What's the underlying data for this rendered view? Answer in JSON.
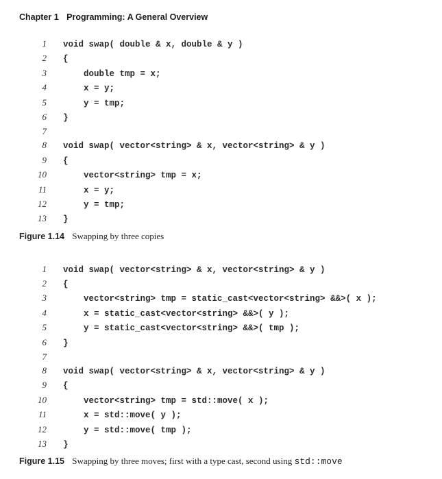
{
  "header": {
    "chapter_num": "Chapter 1",
    "chapter_title": "Programming: A General Overview"
  },
  "listing1": {
    "lines": [
      {
        "n": "1",
        "t": "void swap( double & x, double & y )"
      },
      {
        "n": "2",
        "t": "{"
      },
      {
        "n": "3",
        "t": "    double tmp = x;"
      },
      {
        "n": "4",
        "t": "    x = y;"
      },
      {
        "n": "5",
        "t": "    y = tmp;"
      },
      {
        "n": "6",
        "t": "}"
      },
      {
        "n": "7",
        "t": ""
      },
      {
        "n": "8",
        "t": "void swap( vector<string> & x, vector<string> & y )"
      },
      {
        "n": "9",
        "t": "{"
      },
      {
        "n": "10",
        "t": "    vector<string> tmp = x;"
      },
      {
        "n": "11",
        "t": "    x = y;"
      },
      {
        "n": "12",
        "t": "    y = tmp;"
      },
      {
        "n": "13",
        "t": "}"
      }
    ]
  },
  "figure1": {
    "label": "Figure 1.14",
    "text": "Swapping by three copies"
  },
  "listing2": {
    "lines": [
      {
        "n": "1",
        "t": "void swap( vector<string> & x, vector<string> & y )"
      },
      {
        "n": "2",
        "t": "{"
      },
      {
        "n": "3",
        "t": "    vector<string> tmp = static_cast<vector<string> &&>( x );"
      },
      {
        "n": "4",
        "t": "    x = static_cast<vector<string> &&>( y );"
      },
      {
        "n": "5",
        "t": "    y = static_cast<vector<string> &&>( tmp );"
      },
      {
        "n": "6",
        "t": "}"
      },
      {
        "n": "7",
        "t": ""
      },
      {
        "n": "8",
        "t": "void swap( vector<string> & x, vector<string> & y )"
      },
      {
        "n": "9",
        "t": "{"
      },
      {
        "n": "10",
        "t": "    vector<string> tmp = std::move( x );"
      },
      {
        "n": "11",
        "t": "    x = std::move( y );"
      },
      {
        "n": "12",
        "t": "    y = std::move( tmp );"
      },
      {
        "n": "13",
        "t": "}"
      }
    ]
  },
  "figure2": {
    "label": "Figure 1.15",
    "text_a": "Swapping by three moves; first with a type cast, second using ",
    "text_mono": "std::move"
  }
}
